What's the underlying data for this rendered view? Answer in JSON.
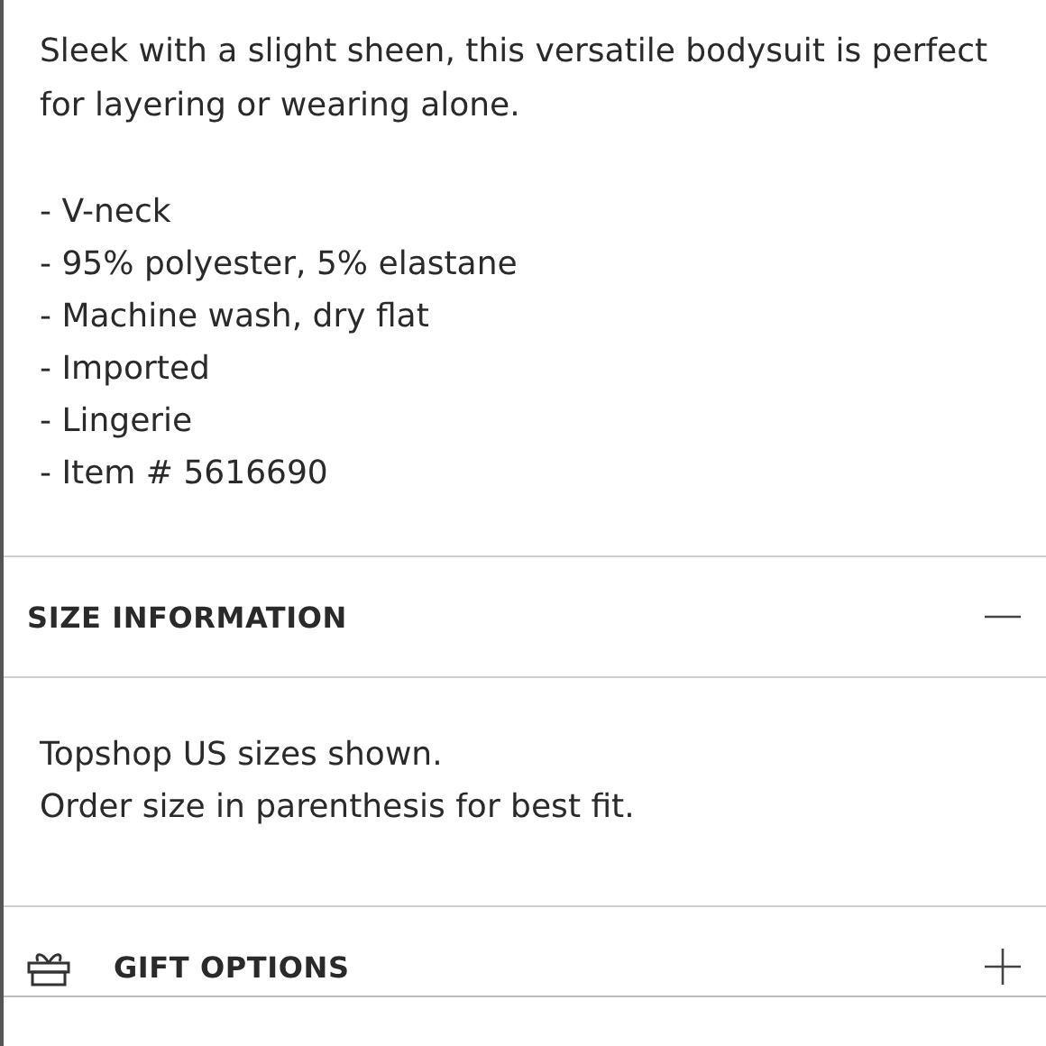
{
  "description": {
    "paragraph": "Sleek with a slight sheen, this versatile bodysuit is perfect for layering or wearing alone.",
    "bullets": [
      "- V-neck",
      "- 95% polyester, 5% elastane",
      "- Machine wash, dry flat",
      "- Imported",
      "- Lingerie",
      "- Item # 5616690"
    ]
  },
  "sections": [
    {
      "title": "SIZE INFORMATION",
      "expanded": true,
      "lines": [
        "Topshop US sizes shown.",
        "Order size in parenthesis for best fit."
      ]
    },
    {
      "title": "GIFT OPTIONS",
      "expanded": false,
      "kind": "gift"
    }
  ]
}
